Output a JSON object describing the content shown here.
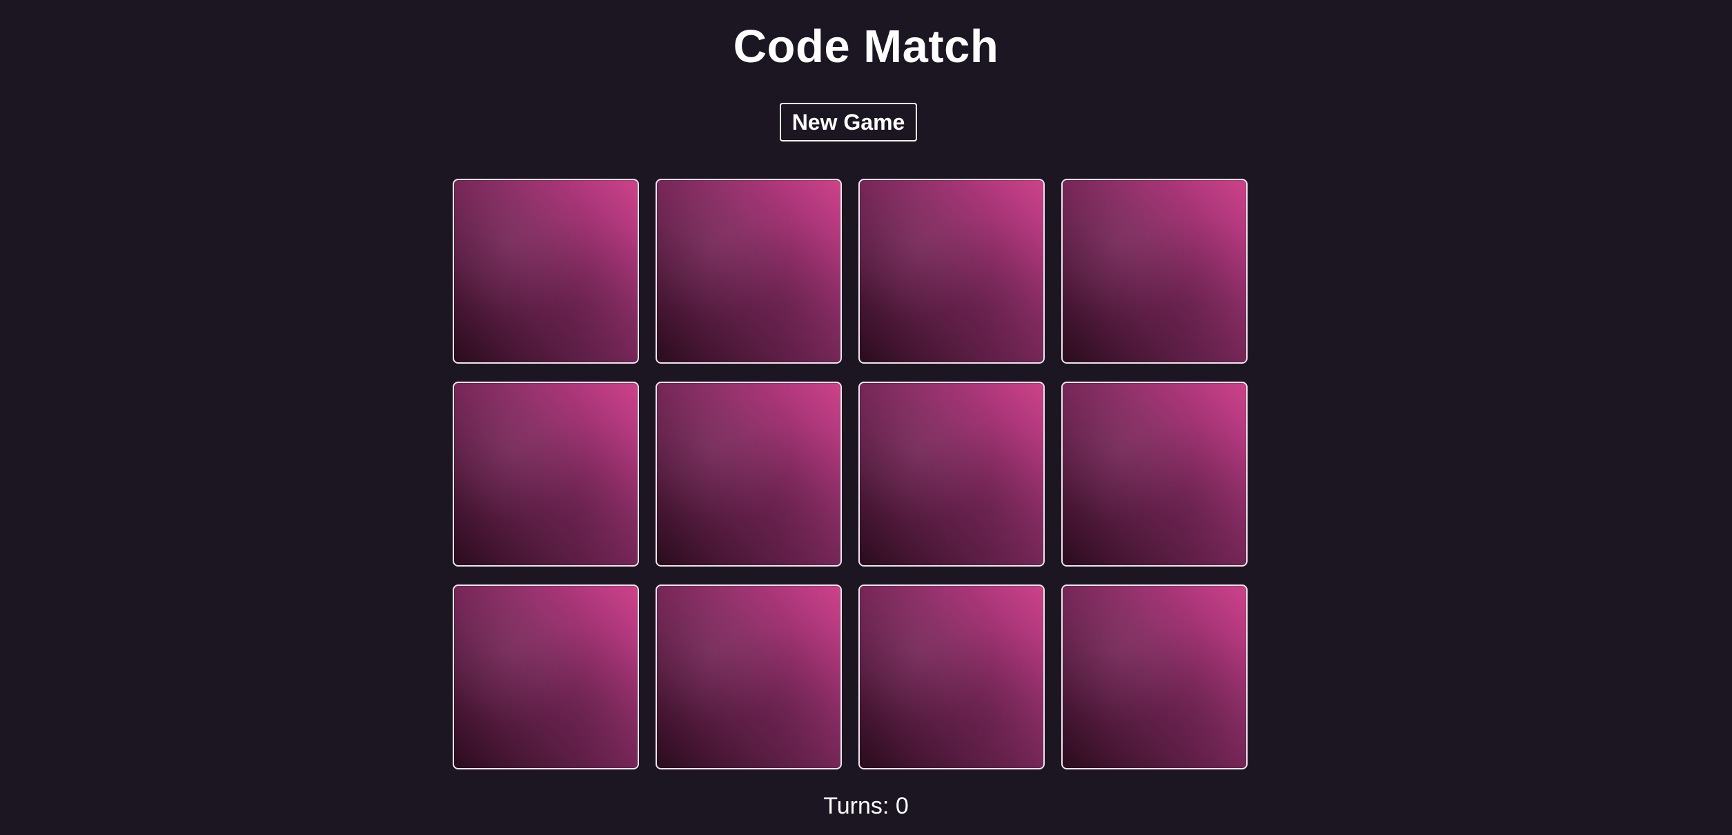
{
  "app": {
    "title": "Code Match"
  },
  "controls": {
    "new_game_label": "New Game"
  },
  "board": {
    "rows": 3,
    "columns": 4,
    "cards": [
      {
        "state": "face-down"
      },
      {
        "state": "face-down"
      },
      {
        "state": "face-down"
      },
      {
        "state": "face-down"
      },
      {
        "state": "face-down"
      },
      {
        "state": "face-down"
      },
      {
        "state": "face-down"
      },
      {
        "state": "face-down"
      },
      {
        "state": "face-down"
      },
      {
        "state": "face-down"
      },
      {
        "state": "face-down"
      },
      {
        "state": "face-down"
      }
    ]
  },
  "status": {
    "turns_label": "Turns:",
    "turns_value": "0"
  },
  "colors": {
    "background": "#1b1622",
    "card_back_light": "#cd4389",
    "card_back_dark": "#2a0c1d",
    "card_border": "#f1e6ee",
    "text": "#ffffff"
  }
}
